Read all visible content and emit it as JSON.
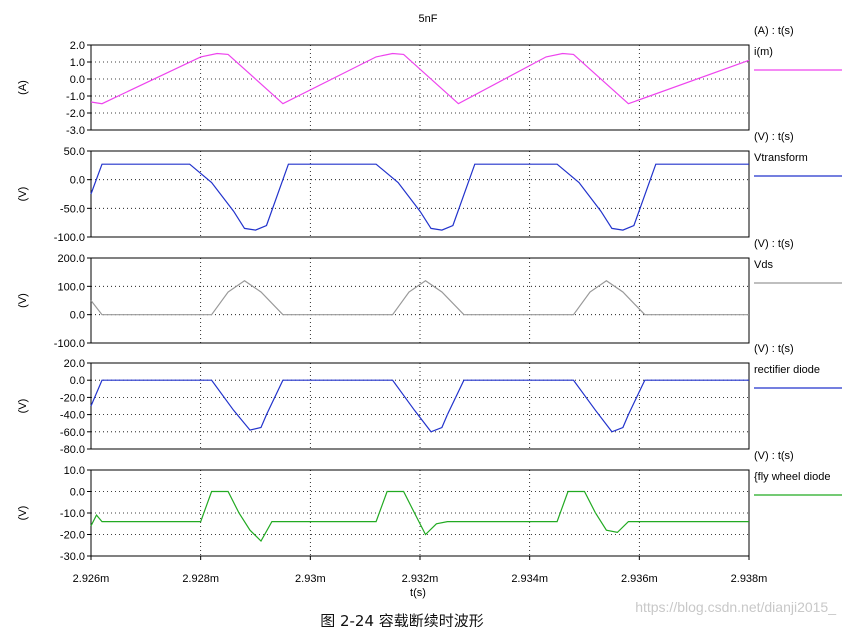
{
  "title": "5nF",
  "x_axis": {
    "label": "t(s)",
    "range": [
      2.926,
      2.938
    ],
    "ticks": [
      2.926,
      2.928,
      2.93,
      2.932,
      2.934,
      2.936,
      2.938
    ],
    "tick_labels": [
      "2.926m",
      "2.928m",
      "2.93m",
      "2.932m",
      "2.934m",
      "2.936m",
      "2.938m"
    ]
  },
  "caption": "图  2-24  容载断续时波形",
  "watermark": "https://blog.csdn.net/dianji2015_",
  "chart_data": [
    {
      "type": "line",
      "xy_label": "(A) : t(s)",
      "ylabel": "(A)",
      "ylim": [
        -3.0,
        2.0
      ],
      "yticks": [
        "2.0",
        "1.0",
        "0.0",
        "-1.0",
        "-2.0",
        "-3.0"
      ],
      "ytick_values": [
        2.0,
        1.0,
        0.0,
        -1.0,
        -2.0,
        -3.0
      ],
      "color": "#ee44ee",
      "series": [
        {
          "name": "i(m)",
          "x": [
            2.926,
            2.9262,
            2.928,
            2.9283,
            2.9285,
            2.9295,
            2.9312,
            2.9315,
            2.9317,
            2.9327,
            2.9343,
            2.9346,
            2.9348,
            2.9358,
            2.938
          ],
          "y": [
            -1.35,
            -1.45,
            1.3,
            1.5,
            1.45,
            -1.45,
            1.3,
            1.5,
            1.45,
            -1.45,
            1.3,
            1.5,
            1.45,
            -1.45,
            1.1
          ]
        }
      ]
    },
    {
      "type": "line",
      "xy_label": "(V) : t(s)",
      "ylabel": "(V)",
      "ylim": [
        -100,
        50
      ],
      "yticks": [
        "50.0",
        "0.0",
        "-50.0",
        "-100.0"
      ],
      "ytick_values": [
        50,
        0,
        -50,
        -100
      ],
      "color": "#2233cc",
      "series": [
        {
          "name": "Vtransform",
          "x": [
            2.926,
            2.9262,
            2.9278,
            2.9282,
            2.9286,
            2.9288,
            2.929,
            2.9292,
            2.9296,
            2.9312,
            2.9316,
            2.932,
            2.9322,
            2.9324,
            2.9326,
            2.933,
            2.9345,
            2.9349,
            2.9353,
            2.9355,
            2.9357,
            2.9359,
            2.9363,
            2.938
          ],
          "y": [
            -25,
            27,
            27,
            -5,
            -55,
            -85,
            -88,
            -80,
            27,
            27,
            -5,
            -55,
            -85,
            -88,
            -80,
            27,
            27,
            -5,
            -55,
            -85,
            -88,
            -80,
            27,
            27
          ]
        }
      ]
    },
    {
      "type": "line",
      "xy_label": "(V) : t(s)",
      "ylabel": "(V)",
      "ylim": [
        -100,
        200
      ],
      "yticks": [
        "200.0",
        "100.0",
        "0.0",
        "-100.0"
      ],
      "ytick_values": [
        200,
        100,
        0,
        -100
      ],
      "color": "#999999",
      "series": [
        {
          "name": "Vds",
          "x": [
            2.926,
            2.9262,
            2.9282,
            2.9285,
            2.9288,
            2.9291,
            2.9295,
            2.9315,
            2.9318,
            2.9321,
            2.9324,
            2.9328,
            2.9348,
            2.9351,
            2.9354,
            2.9357,
            2.9361,
            2.938
          ],
          "y": [
            50,
            0,
            0,
            80,
            120,
            80,
            0,
            0,
            80,
            120,
            80,
            0,
            0,
            80,
            120,
            80,
            0,
            0
          ]
        }
      ]
    },
    {
      "type": "line",
      "xy_label": "(V) : t(s)",
      "ylabel": "(V)",
      "ylim": [
        -80,
        20
      ],
      "yticks": [
        "20.0",
        "0.0",
        "-20.0",
        "-40.0",
        "-60.0",
        "-80.0"
      ],
      "ytick_values": [
        20,
        0,
        -20,
        -40,
        -60,
        -80
      ],
      "color": "#2233cc",
      "series": [
        {
          "name": "rectifier diode",
          "x": [
            2.926,
            2.9262,
            2.9282,
            2.9286,
            2.9289,
            2.9291,
            2.9292,
            2.9295,
            2.9315,
            2.9319,
            2.9322,
            2.9324,
            2.9325,
            2.9328,
            2.9348,
            2.9352,
            2.9355,
            2.9357,
            2.9358,
            2.9361,
            2.938
          ],
          "y": [
            -30,
            0,
            0,
            -35,
            -58,
            -55,
            -40,
            0,
            0,
            -35,
            -60,
            -55,
            -40,
            0,
            0,
            -35,
            -60,
            -55,
            -40,
            0,
            0
          ]
        }
      ]
    },
    {
      "type": "line",
      "xy_label": "(V) : t(s)",
      "ylabel": "(V)",
      "ylim": [
        -30,
        10
      ],
      "yticks": [
        "10.0",
        "0.0",
        "-10.0",
        "-20.0",
        "-30.0"
      ],
      "ytick_values": [
        10,
        0,
        -10,
        -20,
        -30
      ],
      "color": "#22aa22",
      "series": [
        {
          "name": "{fly wheel diode",
          "x": [
            2.926,
            2.9261,
            2.9262,
            2.928,
            2.9282,
            2.9285,
            2.9287,
            2.9289,
            2.9291,
            2.9293,
            2.9295,
            2.9312,
            2.9314,
            2.9317,
            2.9319,
            2.9321,
            2.9323,
            2.9325,
            2.9327,
            2.9345,
            2.9347,
            2.935,
            2.9352,
            2.9354,
            2.9356,
            2.9358,
            2.938
          ],
          "y": [
            -16,
            -11,
            -14,
            -14,
            0,
            0,
            -10,
            -18,
            -23,
            -14,
            -14,
            -14,
            0,
            0,
            -10,
            -20,
            -15,
            -14,
            -14,
            -14,
            0,
            0,
            -10,
            -18,
            -19,
            -14,
            -14
          ]
        }
      ]
    }
  ]
}
